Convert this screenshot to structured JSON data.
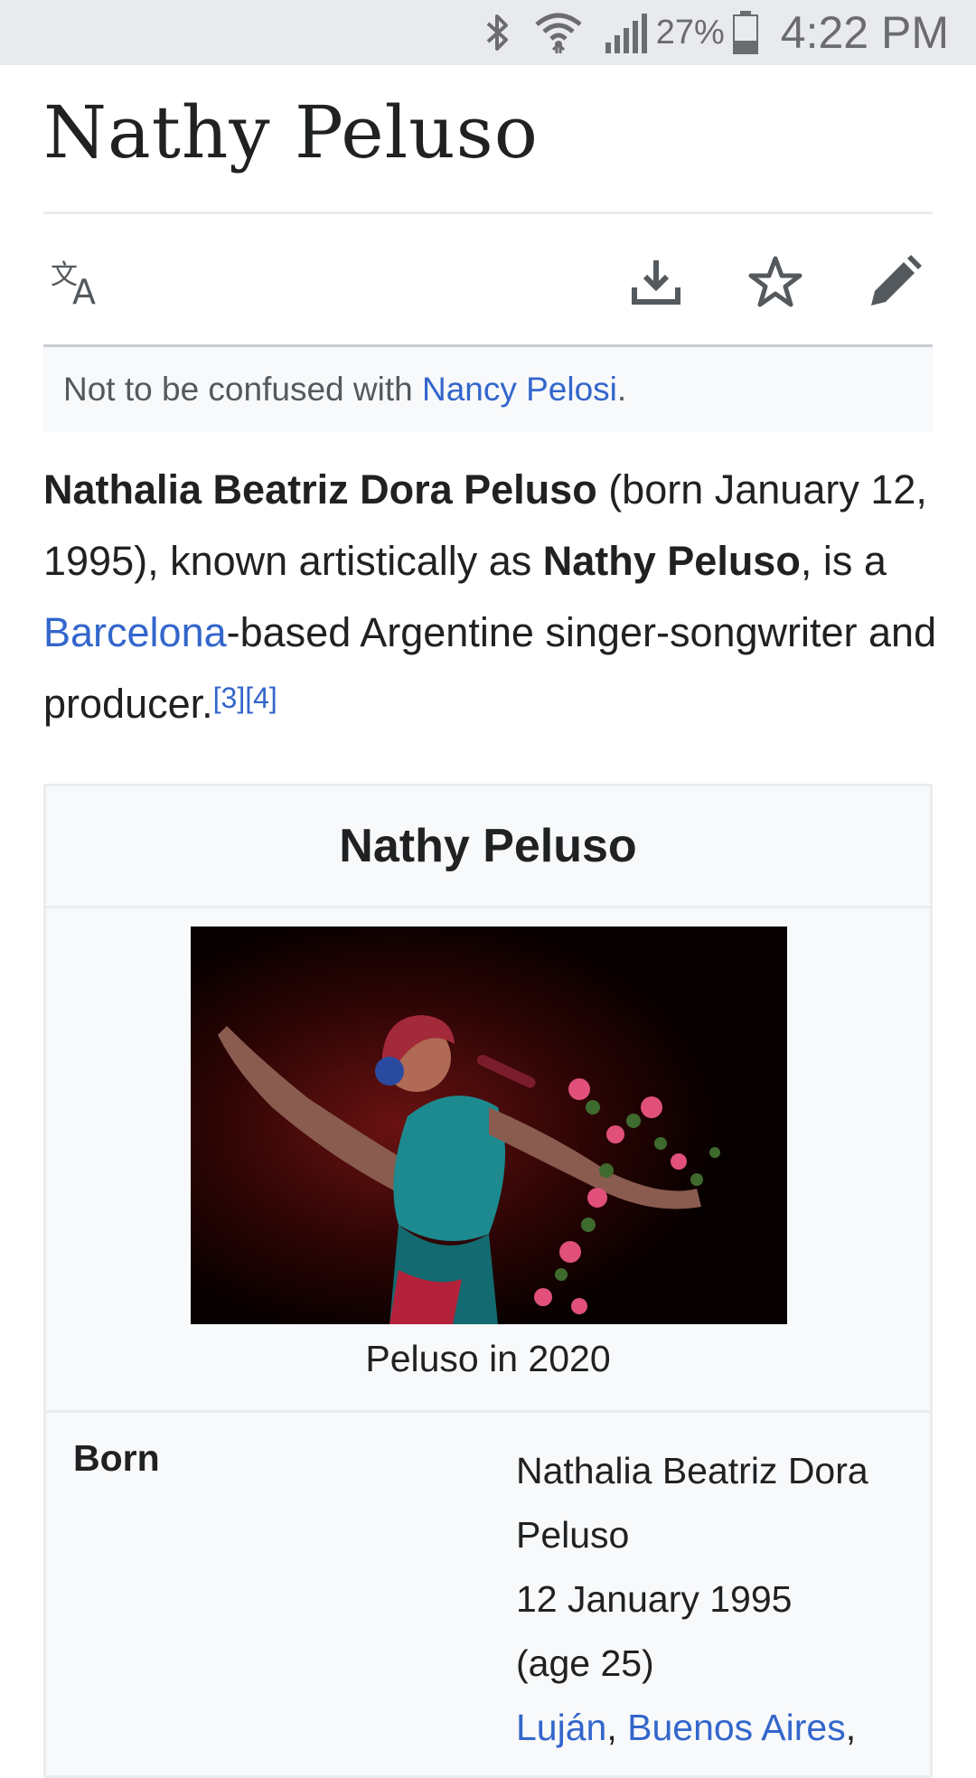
{
  "status_bar": {
    "battery": "27%",
    "time": "4:22 PM",
    "icons": [
      "bluetooth-icon",
      "wifi-icon",
      "signal-icon",
      "battery-icon"
    ]
  },
  "article": {
    "title": "Nathy Peluso",
    "actions": [
      "language-icon",
      "download-icon",
      "star-icon",
      "edit-icon"
    ],
    "hatnote": {
      "prefix": "Not to be confused with ",
      "link": "Nancy Pelosi",
      "suffix": "."
    },
    "lead": {
      "bold_name": "Nathalia Beatriz Dora Peluso",
      "text_1": " (born January 12, 1995), known artistically as ",
      "bold_stage_name": "Nathy Peluso",
      "text_2": ", is a ",
      "link_city": "Barcelona",
      "text_3": "-based Argentine singer-songwriter and producer.",
      "refs": [
        "[3]",
        "[4]"
      ]
    }
  },
  "infobox": {
    "title": "Nathy Peluso",
    "caption": "Peluso in 2020",
    "born_label": "Born",
    "born_name": "Nathalia Beatriz Dora Peluso",
    "born_date": "12 January 1995",
    "born_age": "(age 25)",
    "born_place_1": "Luján",
    "born_place_2": "Buenos Aires",
    "born_sep": ", ",
    "born_trail": ","
  },
  "colors": {
    "link": "#3366cc",
    "text": "#202122",
    "statusbar_bg": "#e9eaec",
    "hatnote_bg": "#f8f9fa"
  }
}
